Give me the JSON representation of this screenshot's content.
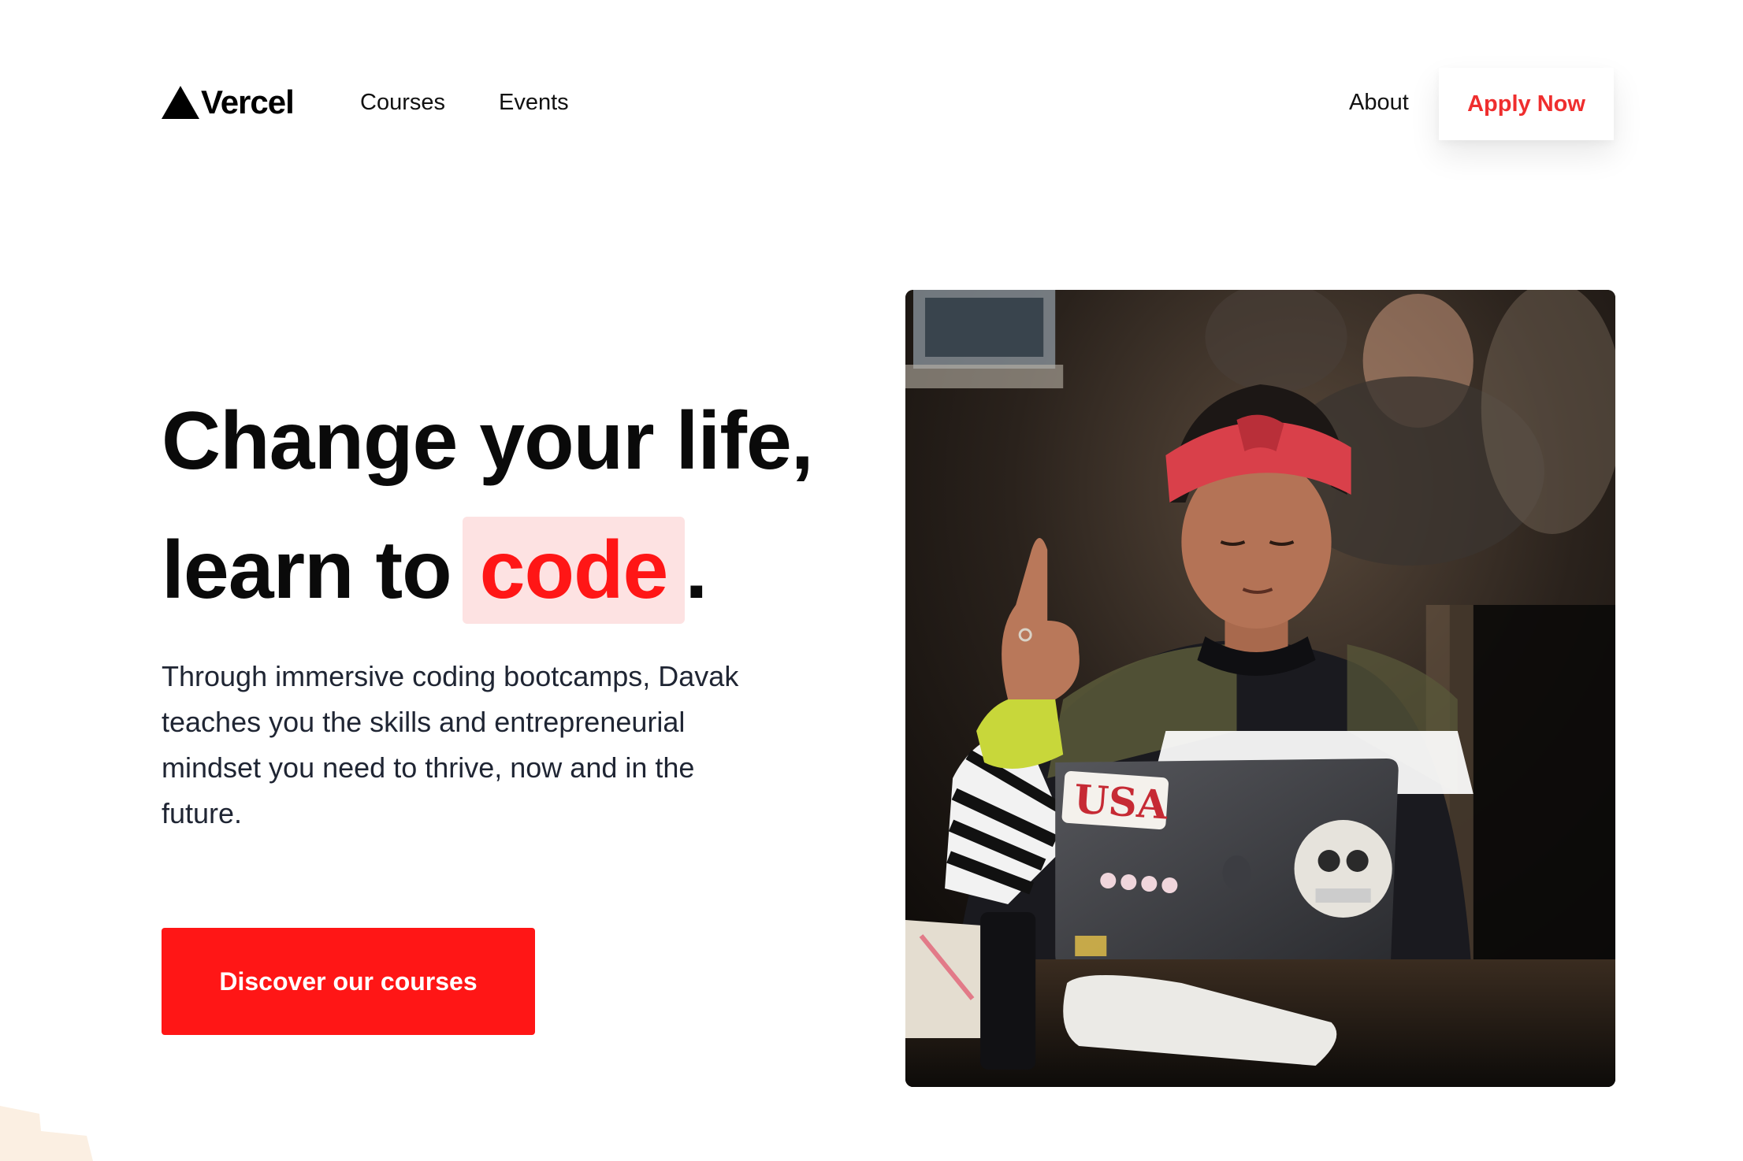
{
  "header": {
    "logo_text": "Vercel",
    "nav": {
      "courses": "Courses",
      "events": "Events",
      "about": "About"
    },
    "apply_label": "Apply Now"
  },
  "hero": {
    "headline_line1": "Change your life,",
    "headline_line2_prefix": "learn to",
    "headline_highlight": "code",
    "headline_suffix": ".",
    "description": "Through immersive coding bootcamps, Davak teaches you the skills and entrepreneurial mindset you need to thrive, now and in the future.",
    "cta_label": "Discover our courses",
    "photo_sticker_text": "USA"
  },
  "colors": {
    "accent": "#ff1616",
    "accent_soft": "#fde2e2",
    "apply_text": "#ef2e2e",
    "text_dark": "#0a0a0a",
    "text_body": "#1f2533"
  },
  "icons": {
    "logo": "triangle-logo-icon"
  }
}
